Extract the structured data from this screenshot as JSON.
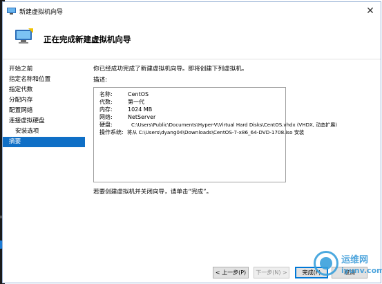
{
  "window": {
    "title": "新建虚拟机向导",
    "close_glyph": "✕"
  },
  "header": {
    "heading": "正在完成新建虚拟机向导"
  },
  "nav": {
    "items": [
      {
        "label": "开始之前"
      },
      {
        "label": "指定名称和位置"
      },
      {
        "label": "指定代数"
      },
      {
        "label": "分配内存"
      },
      {
        "label": "配置网络"
      },
      {
        "label": "连接虚拟硬盘"
      },
      {
        "label": "安装选项"
      },
      {
        "label": "摘要"
      }
    ],
    "selected": "摘要"
  },
  "content": {
    "intro": "你已经成功完成了新建虚拟机向导。即将创建下列虚拟机。",
    "desc_label": "描述:",
    "summary": [
      {
        "key": "名称:",
        "value": "CentOS"
      },
      {
        "key": "代数:",
        "value": "第一代"
      },
      {
        "key": "内存:",
        "value": "1024 MB"
      },
      {
        "key": "网络:",
        "value": "NetServer"
      },
      {
        "key": "硬盘:",
        "value": "C:\\Users\\Public\\Documents\\Hyper-V\\Virtual Hard Disks\\CentOS.vhdx (VHDX, 动态扩展)"
      },
      {
        "key": "操作系统:",
        "value": "将从 C:\\Users\\dyang04\\Downloads\\CentOS-7-x86_64-DVD-1708.iso 安装"
      }
    ],
    "footer_note": "若要创建虚拟机并关闭向导，请单击“完成”。"
  },
  "buttons": {
    "prev": "< 上一步(P)",
    "next": "下一步(N) >",
    "finish": "完成(F)",
    "cancel": "取消"
  },
  "watermark": {
    "cn": "运维网",
    "en": "iyunv.com"
  },
  "colors": {
    "selection": "#0f6fc6",
    "watermark": "#3a9bd9"
  }
}
